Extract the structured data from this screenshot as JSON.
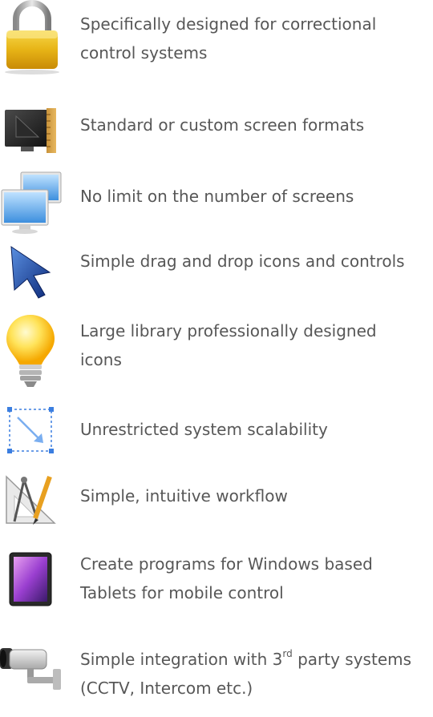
{
  "features": [
    {
      "icon": "padlock-icon",
      "lines": [
        "Specifically designed for correctional",
        "control systems"
      ]
    },
    {
      "icon": "screen-format-icon",
      "lines": [
        "Standard or custom screen formats"
      ]
    },
    {
      "icon": "multiple-monitors-icon",
      "lines": [
        "No limit on the number of screens"
      ]
    },
    {
      "icon": "cursor-arrow-icon",
      "lines": [
        "Simple drag and drop icons and controls"
      ]
    },
    {
      "icon": "light-bulb-icon",
      "lines": [
        "Large library professionally designed",
        "icons"
      ]
    },
    {
      "icon": "scale-resize-icon",
      "lines": [
        "Unrestricted system scalability"
      ]
    },
    {
      "icon": "drafting-tools-icon",
      "lines": [
        "Simple, intuitive workflow"
      ]
    },
    {
      "icon": "tablet-icon",
      "lines": [
        "Create programs for Windows based",
        "Tablets for mobile control"
      ]
    },
    {
      "icon": "cctv-camera-icon",
      "lines_rich": {
        "before": "Simple integration with 3",
        "sup": "rd",
        "after": " party systems",
        "line2": "(CCTV, Intercom etc.)"
      }
    }
  ]
}
